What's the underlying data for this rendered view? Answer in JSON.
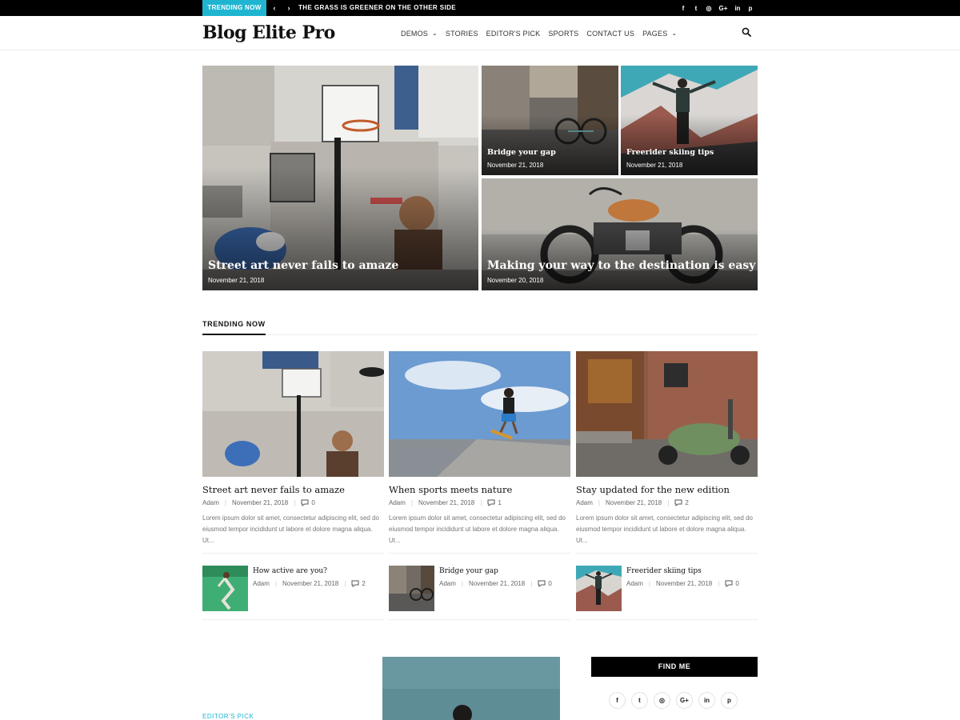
{
  "topbar": {
    "badge": "TRENDING NOW",
    "prev_icon": "chevron-left-icon",
    "next_icon": "chevron-right-icon",
    "headline": "THE GRASS IS GREENER ON THE OTHER SIDE",
    "social": [
      {
        "icon": "facebook-icon",
        "glyph": "f"
      },
      {
        "icon": "twitter-icon",
        "glyph": "t"
      },
      {
        "icon": "instagram-icon",
        "glyph": "◎"
      },
      {
        "icon": "google-plus-icon",
        "glyph": "G+"
      },
      {
        "icon": "linkedin-icon",
        "glyph": "in"
      },
      {
        "icon": "pinterest-icon",
        "glyph": "p"
      }
    ]
  },
  "header": {
    "logo": "Blog Elite Pro",
    "nav": [
      {
        "label": "DEMOS",
        "dropdown": true
      },
      {
        "label": "STORIES",
        "dropdown": false
      },
      {
        "label": "EDITOR'S PICK",
        "dropdown": false
      },
      {
        "label": "SPORTS",
        "dropdown": false
      },
      {
        "label": "CONTACT US",
        "dropdown": false
      },
      {
        "label": "PAGES",
        "dropdown": true
      }
    ],
    "search_icon": "search-icon"
  },
  "hero": [
    {
      "title": "Street art never fails to amaze",
      "date": "November 21, 2018"
    },
    {
      "title": "Bridge your gap",
      "date": "November 21, 2018"
    },
    {
      "title": "Freerider skiing tips",
      "date": "November 21, 2018"
    },
    {
      "title": "Making your way to the destination is easy",
      "date": "November 20, 2018"
    }
  ],
  "trending": {
    "heading": "TRENDING NOW",
    "cards": [
      {
        "title": "Street art never fails to amaze",
        "author": "Adam",
        "date": "November 21, 2018",
        "comments": "0",
        "excerpt": "Lorem ipsum dolor sit amet, consectetur adipiscing elit, sed do eiusmod tempor incididunt ut labore et dolore magna aliqua. Ut..."
      },
      {
        "title": "When sports meets nature",
        "author": "Adam",
        "date": "November 21, 2018",
        "comments": "1",
        "excerpt": "Lorem ipsum dolor sit amet, consectetur adipiscing elit, sed do eiusmod tempor incididunt ut labore et dolore magna aliqua. Ut..."
      },
      {
        "title": "Stay updated for the new edition",
        "author": "Adam",
        "date": "November 21, 2018",
        "comments": "2",
        "excerpt": "Lorem ipsum dolor sit amet, consectetur adipiscing elit, sed do eiusmod tempor incididunt ut labore et dolore magna aliqua. Ut..."
      }
    ],
    "mini": [
      {
        "title": "How active are you?",
        "author": "Adam",
        "date": "November 21, 2018",
        "comments": "2"
      },
      {
        "title": "Bridge your gap",
        "author": "Adam",
        "date": "November 21, 2018",
        "comments": "0"
      },
      {
        "title": "Freerider skiing tips",
        "author": "Adam",
        "date": "November 21, 2018",
        "comments": "0"
      }
    ]
  },
  "bottom": {
    "editors_label": "EDITOR'S PICK",
    "find_me": "FIND ME",
    "social": [
      {
        "icon": "facebook-icon",
        "glyph": "f"
      },
      {
        "icon": "twitter-icon",
        "glyph": "t"
      },
      {
        "icon": "instagram-icon",
        "glyph": "◎"
      },
      {
        "icon": "google-plus-icon",
        "glyph": "G+"
      },
      {
        "icon": "linkedin-icon",
        "glyph": "in"
      },
      {
        "icon": "pinterest-icon",
        "glyph": "p"
      }
    ]
  },
  "colors": {
    "accent": "#1fb5d1",
    "topbar": "#000000"
  }
}
